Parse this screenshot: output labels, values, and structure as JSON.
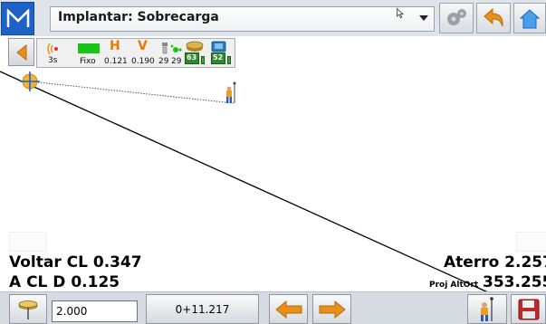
{
  "header": {
    "menu_icon": "m-logo-icon",
    "title": "Implantar: Sobrecarga",
    "settings_icon": "gears-icon",
    "undo_icon": "return-arrow-icon",
    "home_icon": "home-icon"
  },
  "status": {
    "radio_latency": "3s",
    "solution_label": "Fixo",
    "h_label": "H",
    "h_precision": "0.121",
    "v_label": "V",
    "v_precision": "0.190",
    "satellites_a": "29",
    "satellites_b": "29",
    "battery_a": "63",
    "battery_b": "52"
  },
  "readouts": {
    "voltar_cl": "Voltar CL 0.347",
    "a_cl_d": "A CL D 0.125",
    "aterro": "Aterro 2.257",
    "proj_altort_label": "Proj AltOrt",
    "proj_altort_value": "353.255"
  },
  "toolbar": {
    "antenna_height": "2.000",
    "station": "0+11.217"
  },
  "colors": {
    "accent_blue": "#1e62c8",
    "arrow_orange": "#e8901a",
    "signal_green": "#18c418",
    "hv_orange": "#e87a00"
  }
}
